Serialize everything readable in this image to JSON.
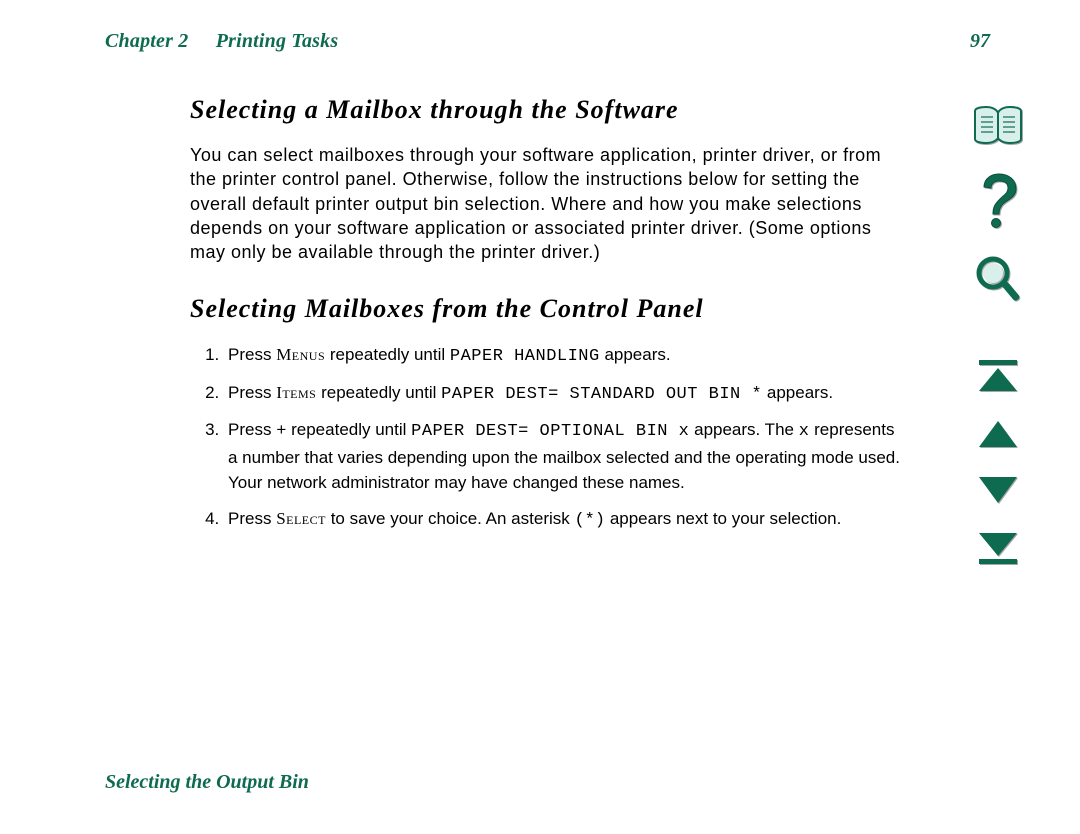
{
  "header": {
    "chapter_label": "Chapter 2",
    "chapter_title": "Printing Tasks",
    "page_number": "97"
  },
  "section1": {
    "title": "Selecting a Mailbox through the Software",
    "body": "You can select mailboxes through your software application, printer driver, or from the printer control panel. Otherwise, follow the instructions below for setting the overall default printer output bin selection. Where and how you make selections depends on your software application or associated printer driver. (Some options may only be available through the printer driver.)"
  },
  "section2": {
    "title": "Selecting Mailboxes from the Control Panel",
    "steps": {
      "s1": {
        "pre": "Press ",
        "key": "Menus",
        "mid": " repeatedly until ",
        "panel": "PAPER HANDLING",
        "post": " appears."
      },
      "s2": {
        "pre": "Press ",
        "key": "Items",
        "mid": " repeatedly until ",
        "panel": "PAPER DEST= STANDARD OUT BIN *",
        "post": " appears."
      },
      "s3": {
        "pre": "Press ",
        "plus": "+",
        "mid": " repeatedly until ",
        "panel": "PAPER DEST= OPTIONAL BIN x",
        "post1": " appears. The ",
        "x": "x",
        "post2": " represents a number that varies depending upon the mailbox selected and the operating mode used. Your network administrator may have changed these names."
      },
      "s4": {
        "pre": "Press ",
        "key": "Select",
        "mid": " to save your choice. An asterisk ",
        "ast": "(*)",
        "post": " appears next to your selection."
      }
    }
  },
  "footer": {
    "text": "Selecting the Output Bin"
  },
  "nav": {
    "book": "toc-icon",
    "help": "help-icon",
    "search": "search-icon",
    "first": "first-page-icon",
    "prev": "previous-page-icon",
    "next": "next-page-icon",
    "last": "last-page-icon"
  },
  "colors": {
    "accent": "#0f6b50"
  }
}
